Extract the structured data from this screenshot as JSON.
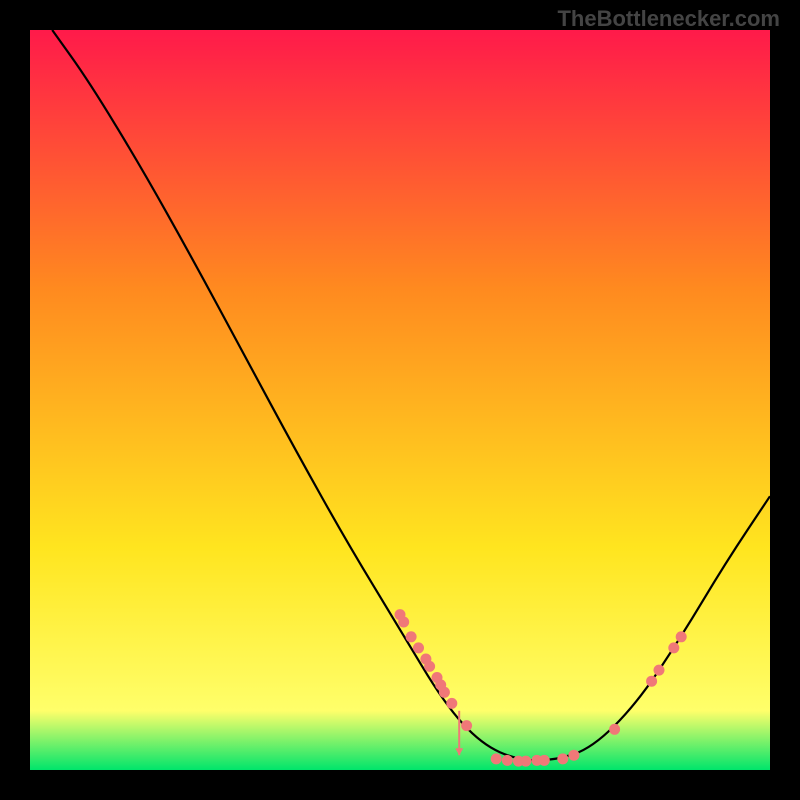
{
  "watermark": "TheBottlenecker.com",
  "chart_data": {
    "type": "line",
    "title": "",
    "xlabel": "",
    "ylabel": "",
    "xlim": [
      0,
      100
    ],
    "ylim": [
      0,
      100
    ],
    "grid": false,
    "legend": false,
    "background_gradient": {
      "top": "#ff1a4a",
      "mid_upper": "#ff8a1f",
      "mid_lower": "#ffe51f",
      "bottom_band": "#ffff6a",
      "bottom_edge": "#00e56b"
    },
    "curve": [
      {
        "x": 3.0,
        "y": 100.0
      },
      {
        "x": 8.0,
        "y": 93.0
      },
      {
        "x": 15.0,
        "y": 81.5
      },
      {
        "x": 22.0,
        "y": 69.0
      },
      {
        "x": 29.0,
        "y": 56.0
      },
      {
        "x": 36.0,
        "y": 43.0
      },
      {
        "x": 43.0,
        "y": 30.5
      },
      {
        "x": 50.0,
        "y": 19.0
      },
      {
        "x": 56.0,
        "y": 9.0
      },
      {
        "x": 61.0,
        "y": 3.5
      },
      {
        "x": 66.0,
        "y": 1.3
      },
      {
        "x": 71.0,
        "y": 1.3
      },
      {
        "x": 76.0,
        "y": 3.0
      },
      {
        "x": 82.0,
        "y": 9.0
      },
      {
        "x": 88.0,
        "y": 18.0
      },
      {
        "x": 94.0,
        "y": 28.0
      },
      {
        "x": 100.0,
        "y": 37.0
      }
    ],
    "points": [
      {
        "x": 50.0,
        "y": 21.0
      },
      {
        "x": 50.5,
        "y": 20.0
      },
      {
        "x": 51.5,
        "y": 18.0
      },
      {
        "x": 52.5,
        "y": 16.5
      },
      {
        "x": 53.5,
        "y": 15.0
      },
      {
        "x": 54.0,
        "y": 14.0
      },
      {
        "x": 55.0,
        "y": 12.5
      },
      {
        "x": 55.5,
        "y": 11.5
      },
      {
        "x": 56.0,
        "y": 10.5
      },
      {
        "x": 57.0,
        "y": 9.0
      },
      {
        "x": 59.0,
        "y": 6.0
      },
      {
        "x": 63.0,
        "y": 1.5
      },
      {
        "x": 64.5,
        "y": 1.3
      },
      {
        "x": 66.0,
        "y": 1.2
      },
      {
        "x": 67.0,
        "y": 1.2
      },
      {
        "x": 68.5,
        "y": 1.3
      },
      {
        "x": 69.5,
        "y": 1.3
      },
      {
        "x": 72.0,
        "y": 1.5
      },
      {
        "x": 73.5,
        "y": 2.0
      },
      {
        "x": 79.0,
        "y": 5.5
      },
      {
        "x": 84.0,
        "y": 12.0
      },
      {
        "x": 85.0,
        "y": 13.5
      },
      {
        "x": 87.0,
        "y": 16.5
      },
      {
        "x": 88.0,
        "y": 18.0
      }
    ],
    "arrow": {
      "x": 58.0,
      "y_from": 8.0,
      "y_to": 2.0
    }
  }
}
